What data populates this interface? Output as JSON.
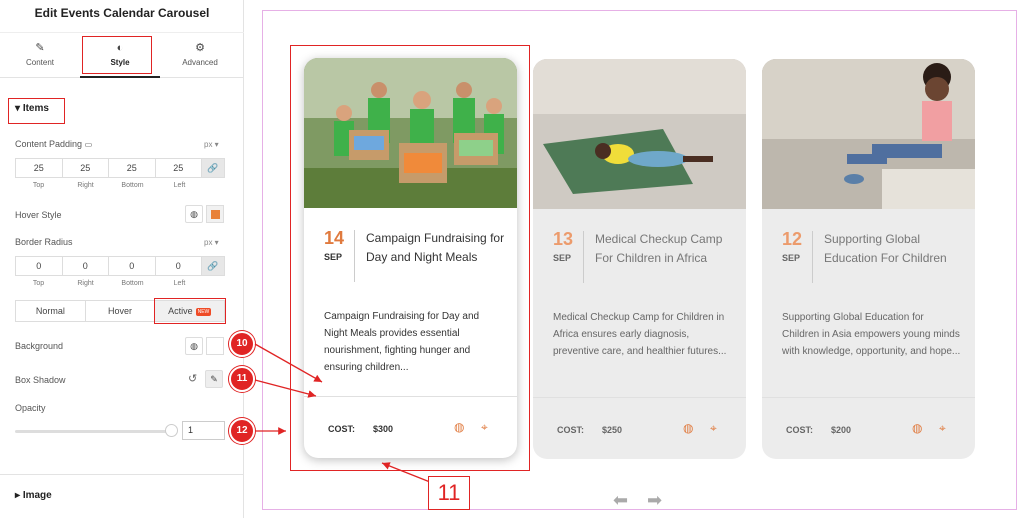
{
  "panel": {
    "title": "Edit Events Calendar Carousel",
    "tabs": [
      {
        "label": "Content",
        "icon": "pencil-icon"
      },
      {
        "label": "Style",
        "icon": "contrast-icon"
      },
      {
        "label": "Advanced",
        "icon": "gear-icon"
      }
    ],
    "section_items": "Items",
    "content_padding": {
      "label": "Content Padding",
      "unit": "px",
      "values": [
        "25",
        "25",
        "25",
        "25"
      ],
      "sublabels": [
        "Top",
        "Right",
        "Bottom",
        "Left"
      ]
    },
    "hover_style": {
      "label": "Hover Style",
      "swatch": "#e8823a"
    },
    "border_radius": {
      "label": "Border Radius",
      "unit": "px",
      "values": [
        "0",
        "0",
        "0",
        "0"
      ],
      "sublabels": [
        "Top",
        "Right",
        "Bottom",
        "Left"
      ]
    },
    "states": {
      "normal": "Normal",
      "hover": "Hover",
      "active": "Active",
      "new_badge": "NEW"
    },
    "background": {
      "label": "Background"
    },
    "box_shadow": {
      "label": "Box Shadow"
    },
    "opacity": {
      "label": "Opacity",
      "value": "1"
    },
    "section_image": "Image"
  },
  "markers": [
    "10",
    "11",
    "12"
  ],
  "preview_marker": "11",
  "cards": [
    {
      "day": "14",
      "month": "SEP",
      "title": "Campaign Fundraising for Day and Night Meals",
      "desc": "Campaign Fundraising for Day and Night Meals provides essential nourishment, fighting hunger and ensuring children...",
      "cost_label": "COST:",
      "price": "$300"
    },
    {
      "day": "13",
      "month": "SEP",
      "title": "Medical Checkup Camp For Children in Africa",
      "desc": "Medical Checkup Camp for Children in Africa ensures early diagnosis, preventive care, and healthier futures...",
      "cost_label": "COST:",
      "price": "$250"
    },
    {
      "day": "12",
      "month": "SEP",
      "title": "Supporting Global Education For Children",
      "desc": "Supporting Global Education for Children in Asia empowers young minds with knowledge, opportunity, and hope...",
      "cost_label": "COST:",
      "price": "$200"
    }
  ],
  "colors": {
    "accent": "#e07a3e",
    "highlight": "#e02424"
  }
}
